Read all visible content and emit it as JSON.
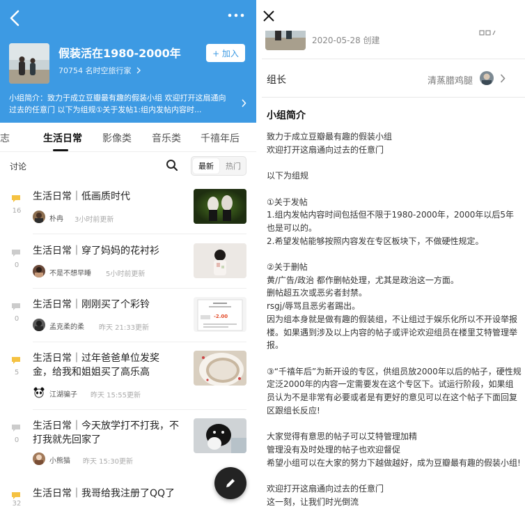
{
  "group": {
    "name": "假装活在1980-2000年",
    "member_meta": "70754 名时空旅行家",
    "join_label": "+ 加入",
    "intro_label": "小组简介：",
    "intro_text": "致力于成立豆瓣最有趣的假装小组 欢迎打开这扇通向过去的任意门 以下为组规①关于发帖1:组内发帖内容时...",
    "header_color": "#3d9ae3"
  },
  "tabs": [
    {
      "label": "杂志"
    },
    {
      "label": "生活日常"
    },
    {
      "label": "影像类"
    },
    {
      "label": "音乐类"
    },
    {
      "label": "千禧年后"
    }
  ],
  "discussion": {
    "title": "讨论",
    "sort_new": "最新",
    "sort_hot": "热门"
  },
  "posts": [
    {
      "title": "生活日常｜低画质时代",
      "count": "16",
      "author": "朴冉",
      "time": "3小时前更新",
      "highlight": true
    },
    {
      "title": "生活日常｜穿了妈妈的花衬衫",
      "count": "0",
      "author": "不是不想早睡",
      "time": "5小时前更新",
      "highlight": false
    },
    {
      "title": "生活日常｜刚刚买了个彩铃",
      "count": "0",
      "author": "孟克柔的柔",
      "time": "昨天 21:33更新",
      "highlight": false
    },
    {
      "title": "生活日常｜过年爸爸单位发奖金，给我和姐姐买了高乐高",
      "count": "5",
      "author": "江湖骗子",
      "time": "昨天 15:55更新",
      "highlight": true
    },
    {
      "title": "生活日常｜今天放学打不打我，不打我就先回家了",
      "count": "0",
      "author": "小熊猫",
      "time": "昨天 15:30更新",
      "highlight": false
    },
    {
      "title": "生活日常｜我哥给我注册了QQ了",
      "count": "32",
      "author": "",
      "time": "",
      "highlight": true
    }
  ],
  "thumb_text": {
    "price": "-2.00"
  },
  "detail": {
    "created": "2020-05-28  创建",
    "leader_label": "组长",
    "leader_name": "清蒸腊鸡腿",
    "intro_heading": "小组简介",
    "body": "致力于成立豆瓣最有趣的假装小组\n欢迎打开这扇通向过去的任意门\n\n以下为组规\n\n①关于发帖\n1.组内发帖内容时间包括但不限于1980-2000年，2000年以后5年也是可以的。\n2.希望发帖能够按照内容发在专区板块下，不做硬性规定。\n\n②关于删帖\n黄/广告/政治 都作删帖处理，尤其是政治这一方面。\n删帖超五次或恶劣者封禁。\nrsgj/辱骂且恶劣者踢出。\n因为组本身就是做有趣的假装组，不让组过于娱乐化所以不开设举报楼。如果遇到涉及以上内容的帖子或评论欢迎组员在楼里艾特管理举报。\n\n③“千禧年后”为新开设的专区，供组员放2000年以后的帖子，硬性规定泛2000年的内容一定需要发在这个专区下。试运行阶段，如果组员认为不是非常有必要或者是有更好的意见可以在这个帖子下面回复区跟组长反应!\n\n大家觉得有意思的帖子可以艾特管理加精\n管理没有及时处理的帖子也欢迎督促\n希望小组可以在大家的努力下越做越好，成为豆瓣最有趣的假装小组!\n\n欢迎打开这扇通向过去的任意门\n这一刻，让我们时光倒流"
  },
  "colors": {
    "accent": "#3d9ae3",
    "comment_highlight": "#f5c242",
    "comment_muted": "#cccccc"
  }
}
